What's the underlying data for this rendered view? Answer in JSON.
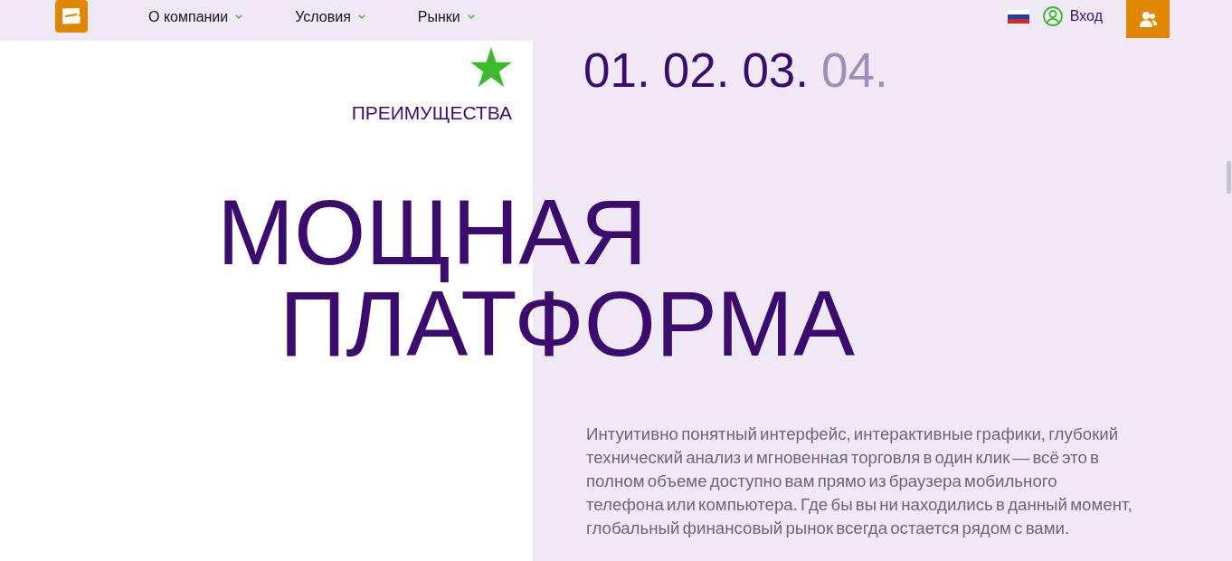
{
  "header": {
    "nav": [
      {
        "label": "О компании"
      },
      {
        "label": "Условия"
      },
      {
        "label": "Рынки"
      }
    ],
    "login": "Вход"
  },
  "hero": {
    "section_label": "ПРЕИМУЩЕСТВА",
    "steps": [
      {
        "label": "01.",
        "active": true
      },
      {
        "label": "02.",
        "active": true
      },
      {
        "label": "03.",
        "active": true
      },
      {
        "label": "04.",
        "active": false
      }
    ],
    "title_lines": [
      "МОЩНАЯ",
      "ПЛАТФОРМА"
    ],
    "description": "Интуитивно понятный интерфейс, интерактивные графики, глубокий технический анализ и мгновенная торговля в один клик — всё это в полном объеме доступно вам прямо из браузера мобильного телефона или компьютера. Где бы вы ни находились в данный момент, глобальный финансовый рынок всегда остается рядом с вами."
  }
}
